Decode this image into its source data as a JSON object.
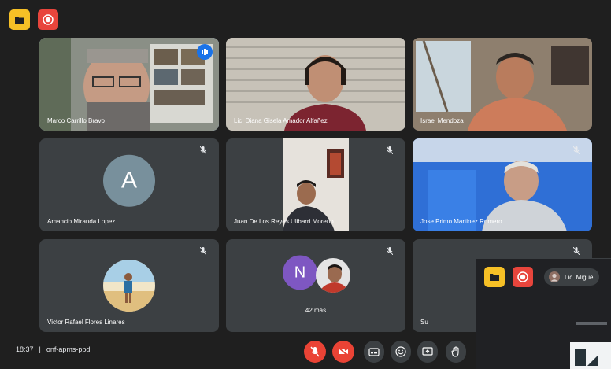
{
  "meeting": {
    "time": "18:37",
    "separator": "|",
    "code": "onf-apms-ppd",
    "more_participants": "42 más"
  },
  "participants": [
    {
      "name": "Marco Carrillo Bravo",
      "speaking": true
    },
    {
      "name": "Lic. Diana Gisela Amador Alfañez"
    },
    {
      "name": "Israel Mendoza"
    },
    {
      "name": "Amancio Miranda Lopez",
      "initial": "A"
    },
    {
      "name": "Juan De Los Reyes Ulibarri Moreno"
    },
    {
      "name": "Jose Primo Martinez Romero"
    },
    {
      "name": "Victor Rafael Flores Linares"
    },
    {
      "name": "",
      "initial": "N"
    },
    {
      "name": "Su"
    }
  ],
  "pip": {
    "name": "Lic. Migue"
  },
  "colors": {
    "background": "#1f1f1f",
    "tile": "#3c4043",
    "accent_blue": "#8ab4f8",
    "end_red": "#ea4335",
    "yellow": "#f6c026",
    "avatar_a": "#78909c",
    "avatar_n": "#7e57c2"
  },
  "icons": {
    "top_left": [
      "folder-icon",
      "record-icon"
    ],
    "controls": [
      "mic-off-icon",
      "camera-off-icon",
      "captions-icon",
      "emoji-icon",
      "present-icon",
      "raise-hand-icon"
    ]
  }
}
